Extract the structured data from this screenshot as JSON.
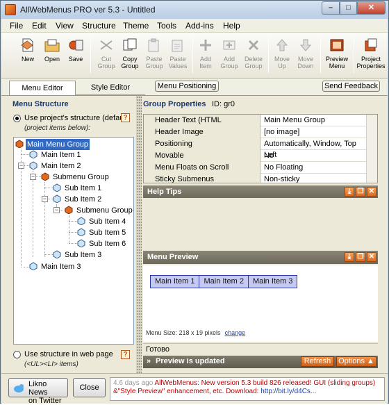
{
  "window": {
    "title": "AllWebMenus PRO ver 5.3 - Untitled",
    "controls": {
      "minimize": "–",
      "maximize": "□",
      "close": "✕"
    }
  },
  "menubar": [
    "File",
    "Edit",
    "View",
    "Structure",
    "Theme",
    "Tools",
    "Add-ins",
    "Help"
  ],
  "toolbar": {
    "new": "New",
    "open": "Open",
    "save": "Save",
    "cut_group": [
      "Cut",
      "Group"
    ],
    "copy_group": [
      "Copy",
      "Group"
    ],
    "paste_group": [
      "Paste",
      "Group"
    ],
    "paste_values": [
      "Paste",
      "Values"
    ],
    "add_item": [
      "Add",
      "Item"
    ],
    "add_group": [
      "Add",
      "Group"
    ],
    "delete_group": [
      "Delete",
      "Group"
    ],
    "move_up": [
      "Move",
      "Up"
    ],
    "move_down": [
      "Move",
      "Down"
    ],
    "preview_menu": [
      "Preview",
      "Menu"
    ],
    "project_properties": [
      "Project",
      "Properties"
    ]
  },
  "tabs": {
    "menu_editor": "Menu Editor",
    "style_editor": "Style Editor",
    "menu_positioning": "Menu Positioning",
    "send_feedback": "Send Feedback"
  },
  "left": {
    "title": "Menu Structure",
    "help": "?",
    "use_project_structure": "Use project's structure (default)",
    "project_items_note": "(project items below):",
    "use_web_structure": "Use structure in web page",
    "web_structure_note": "(<UL><LI> items)",
    "tree": [
      "Main Menu Group",
      "Main Item 1",
      "Main Item 2",
      "Submenu Group",
      "Sub Item 1",
      "Sub Item 2",
      "Submenu Group+",
      "Sub Item 4",
      "Sub Item 5",
      "Sub Item 6",
      "Sub Item 3",
      "Main Item 3"
    ]
  },
  "right": {
    "group_properties": "Group Properties",
    "id_label": "ID: gr0",
    "properties": [
      {
        "name": "Header Text (HTML Formatting)",
        "value": "Main Menu Group"
      },
      {
        "name": "Header Image",
        "value": "[no image]"
      },
      {
        "name": "Positioning",
        "value": "Automatically, Window, Top Left"
      },
      {
        "name": "Movable",
        "value": "No"
      },
      {
        "name": "Menu Floats on Scroll",
        "value": "No Floating"
      },
      {
        "name": "Sticky Submenus",
        "value": "Non-sticky"
      }
    ],
    "help_tips": "Help Tips",
    "menu_preview": "Menu Preview",
    "preview_items": [
      "Main Item 1",
      "Main Item 2",
      "Main Item 3"
    ],
    "menu_size": "Menu Size: 218 x 19 pixels",
    "change": "change",
    "status": "Готово",
    "preview_updated": "Preview is updated",
    "refresh": "Refresh",
    "options": "Options ▲",
    "panel_icons": [
      "⤓",
      "❐",
      "✕"
    ]
  },
  "footer": {
    "likno_news": [
      "Likno News",
      "on Twitter"
    ],
    "close": "Close",
    "news_ago": "4.6 days ago",
    "news_headline": "AllWebMenus: New version 5.3 build 826 released! GUI (sliding groups) &\"Style Preview\" enhancement, etc. Download:",
    "news_link": "http://bit.ly/d4Cs..."
  },
  "colors": {
    "title_bar": "#c9d9ec",
    "toolbar": "#f3f1e8",
    "panel_header": "#7a7567",
    "accent_orange": "#e0772a",
    "selection": "#316ac5",
    "preview_item_bg": "#c6c9f2"
  }
}
